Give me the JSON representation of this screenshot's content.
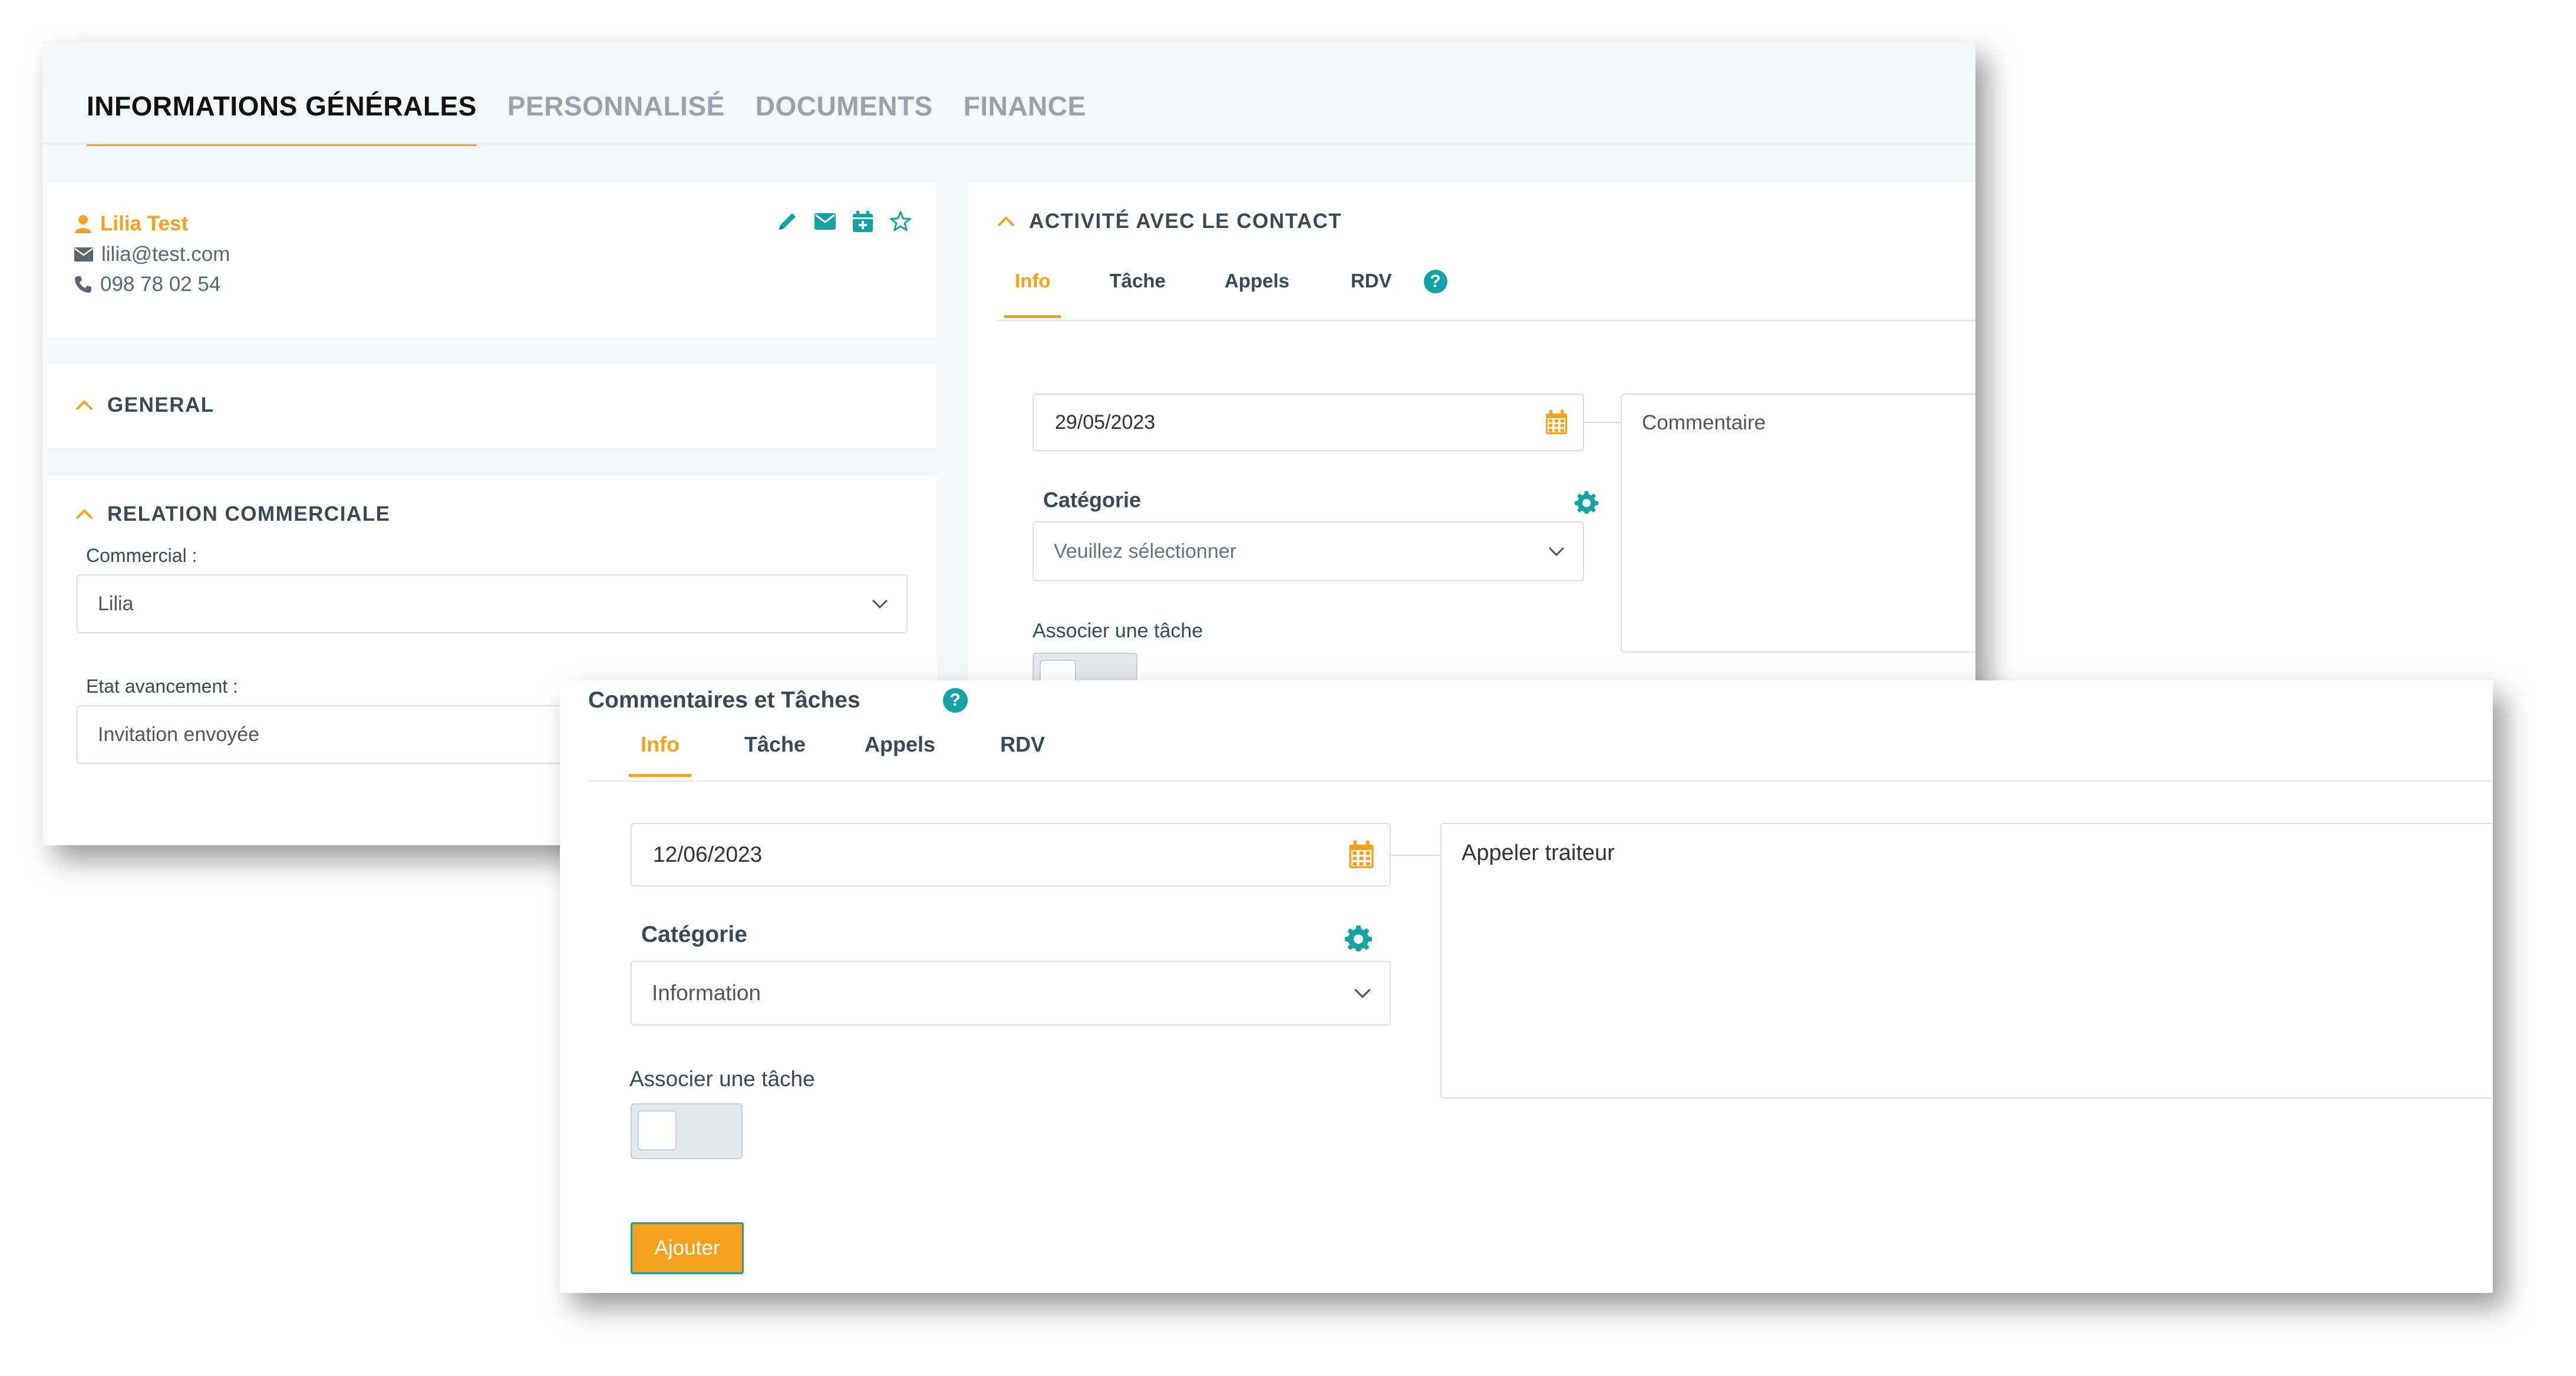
{
  "colors": {
    "accent": "#f4a21d",
    "teal": "#12a3a6",
    "text": "#3c4858",
    "muted": "#9aa3ad"
  },
  "back_panel": {
    "tabs": [
      {
        "label": "INFORMATIONS GÉNÉRALES",
        "active": true
      },
      {
        "label": "PERSONNALISÉ",
        "active": false
      },
      {
        "label": "DOCUMENTS",
        "active": false
      },
      {
        "label": "FINANCE",
        "active": false
      }
    ],
    "contact": {
      "name": "Lilia Test",
      "email": "lilia@test.com",
      "phone": "098 78 02 54",
      "actions": [
        "pencil-icon",
        "envelope-icon",
        "calendar-plus-icon",
        "star-icon"
      ]
    },
    "general_section": {
      "title": "GENERAL"
    },
    "relation_section": {
      "title": "RELATION COMMERCIALE",
      "commercial_label": "Commercial :",
      "commercial_value": "Lilia",
      "etat_label": "Etat avancement :",
      "etat_value": "Invitation envoyée"
    },
    "activity": {
      "title": "ACTIVITÉ AVEC LE CONTACT",
      "tabs": [
        {
          "label": "Info",
          "active": true
        },
        {
          "label": "Tâche",
          "active": false
        },
        {
          "label": "Appels",
          "active": false
        },
        {
          "label": "RDV",
          "active": false
        }
      ],
      "date": "29/05/2023",
      "category_label": "Catégorie",
      "category_placeholder": "Veuillez sélectionner",
      "associate_label": "Associer une tâche",
      "associate_on": false,
      "comment_placeholder": "Commentaire"
    }
  },
  "front_panel": {
    "title": "Commentaires et Tâches",
    "tabs": [
      {
        "label": "Info",
        "active": true
      },
      {
        "label": "Tâche",
        "active": false
      },
      {
        "label": "Appels",
        "active": false
      },
      {
        "label": "RDV",
        "active": false
      }
    ],
    "date": "12/06/2023",
    "category_label": "Catégorie",
    "category_value": "Information",
    "associate_label": "Associer une tâche",
    "associate_on": false,
    "comment": "Appeler traiteur",
    "add_button": "Ajouter"
  }
}
